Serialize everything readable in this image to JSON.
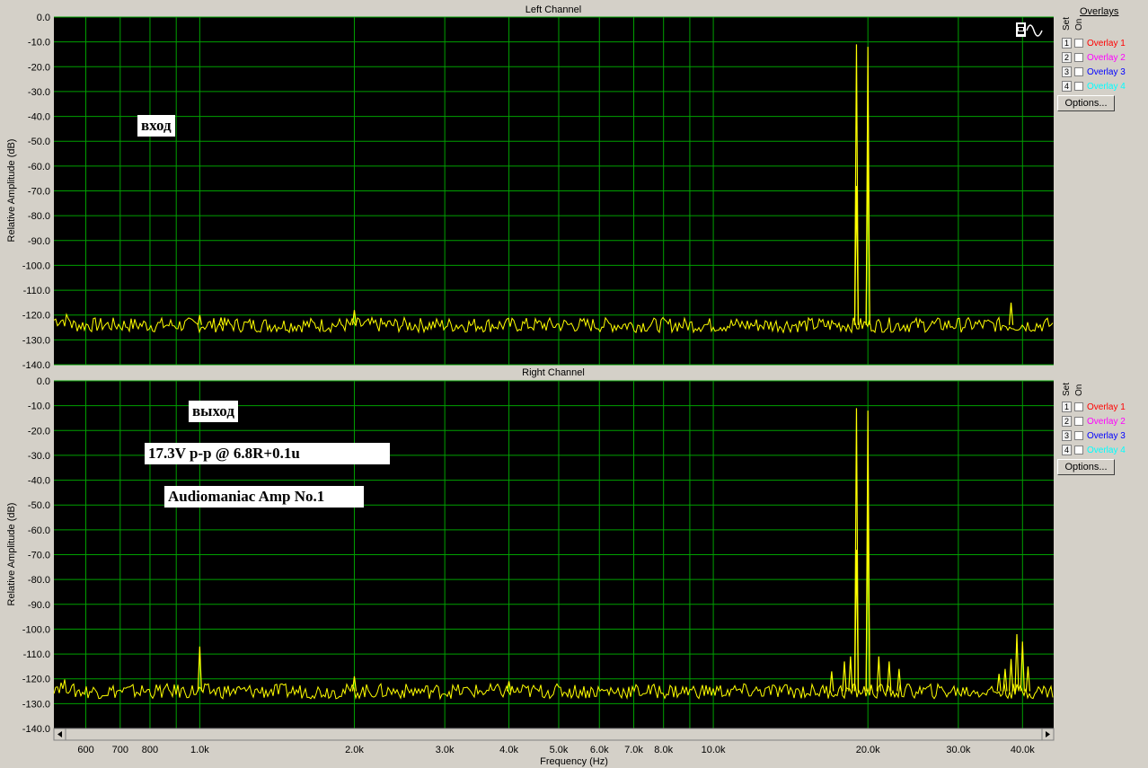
{
  "overlays_title": "Overlays",
  "set_label": "Set",
  "on_label": "On",
  "options_label": "Options...",
  "overlays": [
    {
      "num": "1",
      "label": "Overlay 1",
      "color": "#ff0000"
    },
    {
      "num": "2",
      "label": "Overlay 2",
      "color": "#ff00ff"
    },
    {
      "num": "3",
      "label": "Overlay 3",
      "color": "#0000ff"
    },
    {
      "num": "4",
      "label": "Overlay 4",
      "color": "#00ffff"
    }
  ],
  "annotations": {
    "left": "вход",
    "right": "выход",
    "condition": "17.3V p-p @ 6.8R+0.1u",
    "device": "Audiomaniac Amp No.1"
  },
  "chart_data": [
    {
      "type": "line",
      "title": "Left Channel",
      "xlabel": "",
      "ylabel": "Relative Amplitude (dB)",
      "xscale": "log",
      "xlim": [
        520,
        46000
      ],
      "ylim": [
        -140,
        0
      ],
      "yticks": [
        0,
        -10,
        -20,
        -30,
        -40,
        -50,
        -60,
        -70,
        -80,
        -90,
        -100,
        -110,
        -120,
        -130,
        -140
      ],
      "ytick_labels": [
        "0.0",
        "-10.0",
        "-20.0",
        "-30.0",
        "-40.0",
        "-50.0",
        "-60.0",
        "-70.0",
        "-80.0",
        "-90.0",
        "-100.0",
        "-110.0",
        "-120.0",
        "-130.0",
        "-140.0"
      ],
      "grid": true,
      "line_color": "#ffff00",
      "noise_floor": -124,
      "peaks": [
        {
          "x": 1000,
          "y": -120
        },
        {
          "x": 1100,
          "y": -121
        },
        {
          "x": 2000,
          "y": -118
        },
        {
          "x": 19000,
          "y": -68
        },
        {
          "x": 19000,
          "y": -11
        },
        {
          "x": 20000,
          "y": -12
        },
        {
          "x": 20000,
          "y": -50
        },
        {
          "x": 38000,
          "y": -115
        }
      ]
    },
    {
      "type": "line",
      "title": "Right Channel",
      "xlabel": "Frequency (Hz)",
      "ylabel": "Relative Amplitude (dB)",
      "xscale": "log",
      "xlim": [
        520,
        46000
      ],
      "ylim": [
        -140,
        0
      ],
      "yticks": [
        0,
        -10,
        -20,
        -30,
        -40,
        -50,
        -60,
        -70,
        -80,
        -90,
        -100,
        -110,
        -120,
        -130,
        -140
      ],
      "ytick_labels": [
        "0.0",
        "-10.0",
        "-20.0",
        "-30.0",
        "-40.0",
        "-50.0",
        "-60.0",
        "-70.0",
        "-80.0",
        "-90.0",
        "-100.0",
        "-110.0",
        "-120.0",
        "-130.0",
        "-140.0"
      ],
      "xticks": [
        600,
        700,
        800,
        1000,
        2000,
        3000,
        4000,
        5000,
        6000,
        7000,
        8000,
        10000,
        20000,
        30000,
        40000
      ],
      "xtick_labels": [
        "600",
        "700",
        "800",
        "1.0k",
        "2.0k",
        "3.0k",
        "4.0k",
        "5.0k",
        "6.0k",
        "7.0k",
        "8.0k",
        "10.0k",
        "20.0k",
        "30.0k",
        "40.0k"
      ],
      "grid": true,
      "line_color": "#ffff00",
      "noise_floor": -125,
      "peaks": [
        {
          "x": 1000,
          "y": -107
        },
        {
          "x": 2000,
          "y": -119
        },
        {
          "x": 4000,
          "y": -121
        },
        {
          "x": 17000,
          "y": -117
        },
        {
          "x": 18000,
          "y": -113
        },
        {
          "x": 18500,
          "y": -111
        },
        {
          "x": 19000,
          "y": -68
        },
        {
          "x": 19000,
          "y": -11
        },
        {
          "x": 20000,
          "y": -12
        },
        {
          "x": 20000,
          "y": -50
        },
        {
          "x": 21000,
          "y": -111
        },
        {
          "x": 22000,
          "y": -113
        },
        {
          "x": 23000,
          "y": -116
        },
        {
          "x": 36000,
          "y": -118
        },
        {
          "x": 37000,
          "y": -116
        },
        {
          "x": 38000,
          "y": -112
        },
        {
          "x": 39000,
          "y": -102
        },
        {
          "x": 40000,
          "y": -105
        },
        {
          "x": 41000,
          "y": -115
        }
      ]
    }
  ]
}
